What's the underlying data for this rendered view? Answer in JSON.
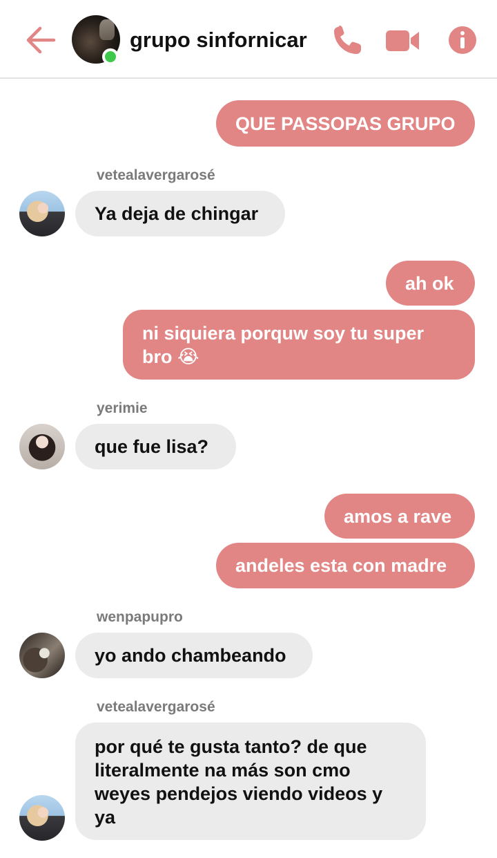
{
  "header": {
    "title": "grupo sinfornicar",
    "online": true,
    "icons": {
      "back": "arrow-left-icon",
      "call": "phone-icon",
      "video": "video-camera-icon",
      "info": "info-icon"
    }
  },
  "colors": {
    "accent": "#e28585",
    "incoming_bubble": "#ebebeb",
    "online": "#3fc94c"
  },
  "messages": [
    {
      "direction": "out",
      "text": "QUE PASSOPAS GRUPO"
    },
    {
      "direction": "in",
      "sender": "vetealavergarosé",
      "text": "Ya deja de chingar"
    },
    {
      "direction": "out",
      "text": "ah ok"
    },
    {
      "direction": "out",
      "text": "ni siquiera porquw soy tu super bro 😭"
    },
    {
      "direction": "in",
      "sender": "yerimie",
      "text": "que fue lisa?"
    },
    {
      "direction": "out",
      "text": "amos a rave"
    },
    {
      "direction": "out",
      "text": "andeles esta con madre"
    },
    {
      "direction": "in",
      "sender": "wenpapupro",
      "text": "yo ando chambeando"
    },
    {
      "direction": "in",
      "sender": "vetealavergarosé",
      "text": "por qué te gusta tanto? de que literalmente na más son cmo weyes pendejos viendo videos y ya"
    }
  ]
}
